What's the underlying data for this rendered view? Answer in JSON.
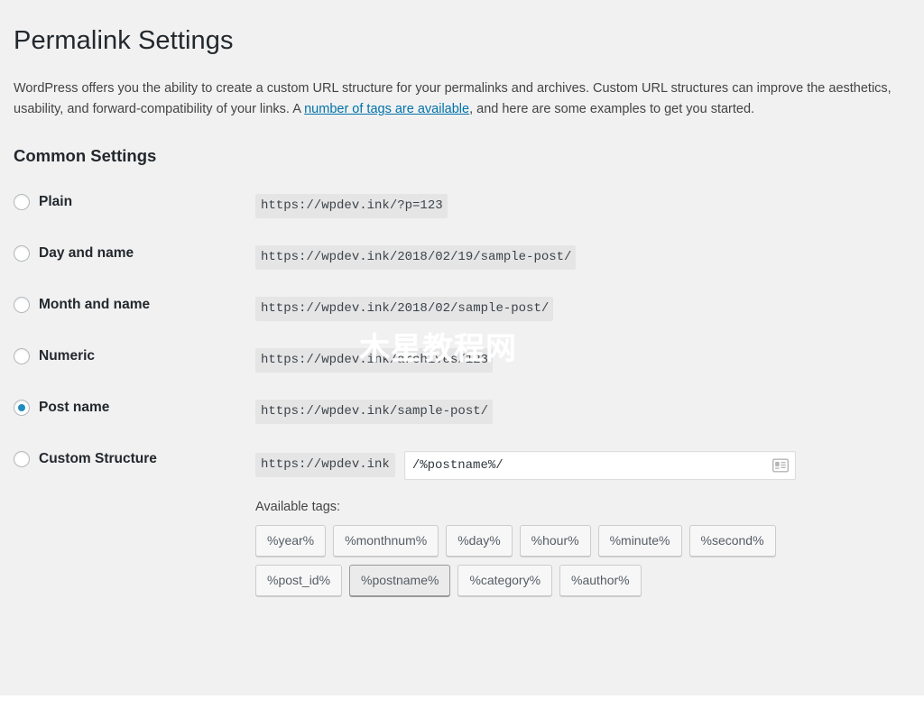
{
  "page": {
    "title": "Permalink Settings",
    "intro_part1": "WordPress offers you the ability to create a custom URL structure for your permalinks and archives. Custom URL structures can improve the aesthetics, usability, and forward-compatibility of your links. A ",
    "intro_link": "number of tags are available",
    "intro_part2": ", and here are some examples to get you started.",
    "section_title": "Common Settings"
  },
  "watermark": {
    "text": "木星教程网"
  },
  "options": [
    {
      "label": "Plain",
      "example": "https://wpdev.ink/?p=123",
      "selected": false
    },
    {
      "label": "Day and name",
      "example": "https://wpdev.ink/2018/02/19/sample-post/",
      "selected": false
    },
    {
      "label": "Month and name",
      "example": "https://wpdev.ink/2018/02/sample-post/",
      "selected": false
    },
    {
      "label": "Numeric",
      "example": "https://wpdev.ink/archives/123",
      "selected": false
    },
    {
      "label": "Post name",
      "example": "https://wpdev.ink/sample-post/",
      "selected": true
    }
  ],
  "custom": {
    "label": "Custom Structure",
    "prefix": "https://wpdev.ink",
    "value": "/%postname%/",
    "autofill_icon": "contact-card-icon",
    "available_tags_label": "Available tags:",
    "tag_rows": [
      [
        {
          "label": "%year%",
          "active": false
        },
        {
          "label": "%monthnum%",
          "active": false
        },
        {
          "label": "%day%",
          "active": false
        },
        {
          "label": "%hour%",
          "active": false
        },
        {
          "label": "%minute%",
          "active": false
        },
        {
          "label": "%second%",
          "active": false
        }
      ],
      [
        {
          "label": "%post_id%",
          "active": false
        },
        {
          "label": "%postname%",
          "active": true
        },
        {
          "label": "%category%",
          "active": false
        },
        {
          "label": "%author%",
          "active": false
        }
      ]
    ]
  },
  "colors": {
    "background": "#f1f1f1",
    "heading": "#23282d",
    "text": "#444444",
    "link": "#0073aa",
    "radio_accent": "#1e8cbe",
    "code_bg": "#e5e5e5"
  }
}
